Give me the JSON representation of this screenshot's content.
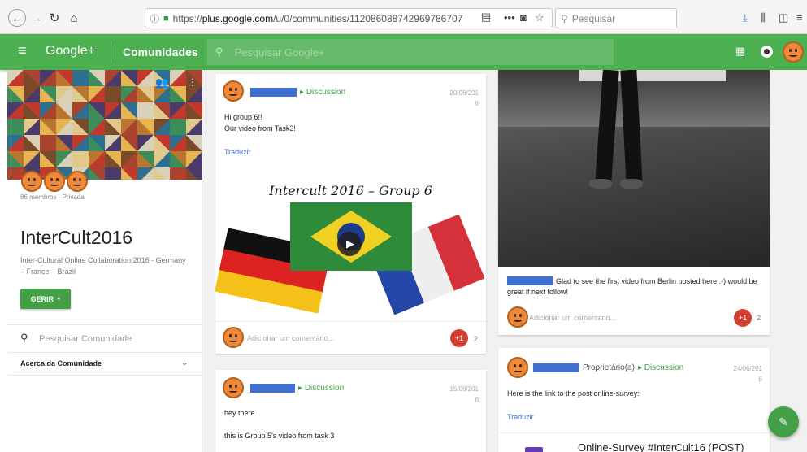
{
  "browser": {
    "url_prefix": "https://",
    "url_domain": "plus.google.com",
    "url_path": "/u/0/communities/112086088742969786707",
    "search_placeholder": "Pesquisar",
    "more_label": "•••"
  },
  "gplus": {
    "brand": "Google+",
    "section": "Comunidades",
    "search_placeholder": "Pesquisar Google+",
    "colors": {
      "bar": "#4caf50",
      "accent": "#43a047",
      "plus_one": "#d23f31",
      "redaction": "#3f6fd0"
    }
  },
  "community": {
    "meta": "86 membros · Privada",
    "name": "InterCult2016",
    "description": "Inter-Cultural Online Collaboration 2016 - Germany – France – Brazil",
    "manage_label": "GERIR",
    "search_placeholder": "Pesquisar Comunidade",
    "about_label": "Acerca da Comunidade"
  },
  "post1": {
    "category": "Discussion",
    "date_line1": "20/06/201",
    "date_line2": "6",
    "text_line1": "Hi group 6!!",
    "text_line2": "Our video from Task3!",
    "translate": "Traduzir",
    "video_title": "Intercult 2016 – Group 6",
    "comment_placeholder": "Adicionar um comentário...",
    "plus_label": "+1",
    "plus_count": "2"
  },
  "post2": {
    "category": "Discussion",
    "date_line1": "15/06/201",
    "date_line2": "6",
    "text_line1": "hey there",
    "text_line2": "this is Group 5's video from task 3"
  },
  "post3": {
    "comment_line1": "Glad to see the first video from Berlin posted here :-) would be",
    "comment_line2": "great if next follow!",
    "comment_placeholder": "Adicionar um comentário...",
    "plus_label": "+1",
    "plus_count": "2"
  },
  "post4": {
    "role": "Proprietário(a)",
    "category": "Discussion",
    "date_line1": "24/06/201",
    "date_line2": "6",
    "text": "Here is the link to the post online-survey:",
    "translate": "Traduzir",
    "link_title": "Online-Survey #InterCult16 (POST)"
  }
}
